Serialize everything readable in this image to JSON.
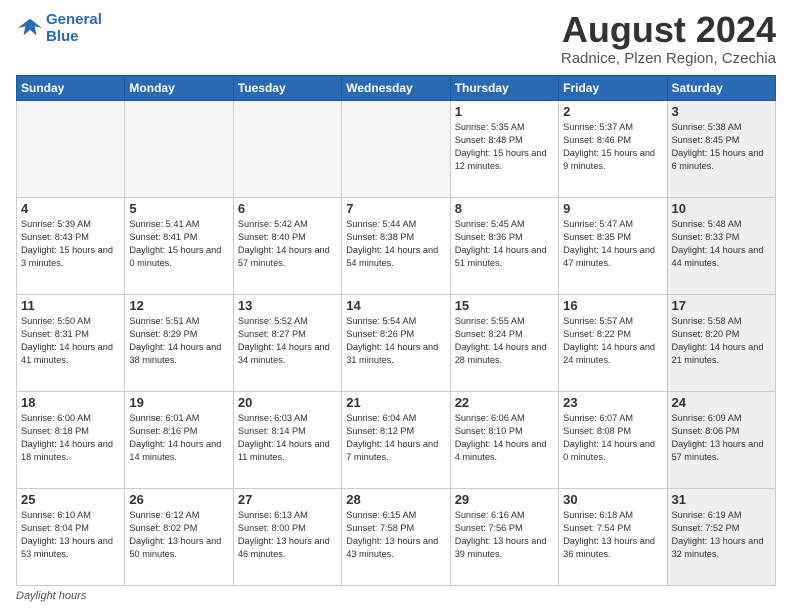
{
  "logo": {
    "line1": "General",
    "line2": "Blue"
  },
  "title": {
    "month_year": "August 2024",
    "location": "Radnice, Plzen Region, Czechia"
  },
  "days_of_week": [
    "Sunday",
    "Monday",
    "Tuesday",
    "Wednesday",
    "Thursday",
    "Friday",
    "Saturday"
  ],
  "footer": {
    "label": "Daylight hours"
  },
  "weeks": [
    [
      {
        "day": "",
        "info": "",
        "empty": true
      },
      {
        "day": "",
        "info": "",
        "empty": true
      },
      {
        "day": "",
        "info": "",
        "empty": true
      },
      {
        "day": "",
        "info": "",
        "empty": true
      },
      {
        "day": "1",
        "info": "Sunrise: 5:35 AM\nSunset: 8:48 PM\nDaylight: 15 hours\nand 12 minutes.",
        "empty": false
      },
      {
        "day": "2",
        "info": "Sunrise: 5:37 AM\nSunset: 8:46 PM\nDaylight: 15 hours\nand 9 minutes.",
        "empty": false
      },
      {
        "day": "3",
        "info": "Sunrise: 5:38 AM\nSunset: 8:45 PM\nDaylight: 15 hours\nand 6 minutes.",
        "empty": false
      }
    ],
    [
      {
        "day": "4",
        "info": "Sunrise: 5:39 AM\nSunset: 8:43 PM\nDaylight: 15 hours\nand 3 minutes.",
        "empty": false
      },
      {
        "day": "5",
        "info": "Sunrise: 5:41 AM\nSunset: 8:41 PM\nDaylight: 15 hours\nand 0 minutes.",
        "empty": false
      },
      {
        "day": "6",
        "info": "Sunrise: 5:42 AM\nSunset: 8:40 PM\nDaylight: 14 hours\nand 57 minutes.",
        "empty": false
      },
      {
        "day": "7",
        "info": "Sunrise: 5:44 AM\nSunset: 8:38 PM\nDaylight: 14 hours\nand 54 minutes.",
        "empty": false
      },
      {
        "day": "8",
        "info": "Sunrise: 5:45 AM\nSunset: 8:36 PM\nDaylight: 14 hours\nand 51 minutes.",
        "empty": false
      },
      {
        "day": "9",
        "info": "Sunrise: 5:47 AM\nSunset: 8:35 PM\nDaylight: 14 hours\nand 47 minutes.",
        "empty": false
      },
      {
        "day": "10",
        "info": "Sunrise: 5:48 AM\nSunset: 8:33 PM\nDaylight: 14 hours\nand 44 minutes.",
        "empty": false
      }
    ],
    [
      {
        "day": "11",
        "info": "Sunrise: 5:50 AM\nSunset: 8:31 PM\nDaylight: 14 hours\nand 41 minutes.",
        "empty": false
      },
      {
        "day": "12",
        "info": "Sunrise: 5:51 AM\nSunset: 8:29 PM\nDaylight: 14 hours\nand 38 minutes.",
        "empty": false
      },
      {
        "day": "13",
        "info": "Sunrise: 5:52 AM\nSunset: 8:27 PM\nDaylight: 14 hours\nand 34 minutes.",
        "empty": false
      },
      {
        "day": "14",
        "info": "Sunrise: 5:54 AM\nSunset: 8:26 PM\nDaylight: 14 hours\nand 31 minutes.",
        "empty": false
      },
      {
        "day": "15",
        "info": "Sunrise: 5:55 AM\nSunset: 8:24 PM\nDaylight: 14 hours\nand 28 minutes.",
        "empty": false
      },
      {
        "day": "16",
        "info": "Sunrise: 5:57 AM\nSunset: 8:22 PM\nDaylight: 14 hours\nand 24 minutes.",
        "empty": false
      },
      {
        "day": "17",
        "info": "Sunrise: 5:58 AM\nSunset: 8:20 PM\nDaylight: 14 hours\nand 21 minutes.",
        "empty": false
      }
    ],
    [
      {
        "day": "18",
        "info": "Sunrise: 6:00 AM\nSunset: 8:18 PM\nDaylight: 14 hours\nand 18 minutes.",
        "empty": false
      },
      {
        "day": "19",
        "info": "Sunrise: 6:01 AM\nSunset: 8:16 PM\nDaylight: 14 hours\nand 14 minutes.",
        "empty": false
      },
      {
        "day": "20",
        "info": "Sunrise: 6:03 AM\nSunset: 8:14 PM\nDaylight: 14 hours\nand 11 minutes.",
        "empty": false
      },
      {
        "day": "21",
        "info": "Sunrise: 6:04 AM\nSunset: 8:12 PM\nDaylight: 14 hours\nand 7 minutes.",
        "empty": false
      },
      {
        "day": "22",
        "info": "Sunrise: 6:06 AM\nSunset: 8:10 PM\nDaylight: 14 hours\nand 4 minutes.",
        "empty": false
      },
      {
        "day": "23",
        "info": "Sunrise: 6:07 AM\nSunset: 8:08 PM\nDaylight: 14 hours\nand 0 minutes.",
        "empty": false
      },
      {
        "day": "24",
        "info": "Sunrise: 6:09 AM\nSunset: 8:06 PM\nDaylight: 13 hours\nand 57 minutes.",
        "empty": false
      }
    ],
    [
      {
        "day": "25",
        "info": "Sunrise: 6:10 AM\nSunset: 8:04 PM\nDaylight: 13 hours\nand 53 minutes.",
        "empty": false
      },
      {
        "day": "26",
        "info": "Sunrise: 6:12 AM\nSunset: 8:02 PM\nDaylight: 13 hours\nand 50 minutes.",
        "empty": false
      },
      {
        "day": "27",
        "info": "Sunrise: 6:13 AM\nSunset: 8:00 PM\nDaylight: 13 hours\nand 46 minutes.",
        "empty": false
      },
      {
        "day": "28",
        "info": "Sunrise: 6:15 AM\nSunset: 7:58 PM\nDaylight: 13 hours\nand 43 minutes.",
        "empty": false
      },
      {
        "day": "29",
        "info": "Sunrise: 6:16 AM\nSunset: 7:56 PM\nDaylight: 13 hours\nand 39 minutes.",
        "empty": false
      },
      {
        "day": "30",
        "info": "Sunrise: 6:18 AM\nSunset: 7:54 PM\nDaylight: 13 hours\nand 36 minutes.",
        "empty": false
      },
      {
        "day": "31",
        "info": "Sunrise: 6:19 AM\nSunset: 7:52 PM\nDaylight: 13 hours\nand 32 minutes.",
        "empty": false
      }
    ]
  ]
}
